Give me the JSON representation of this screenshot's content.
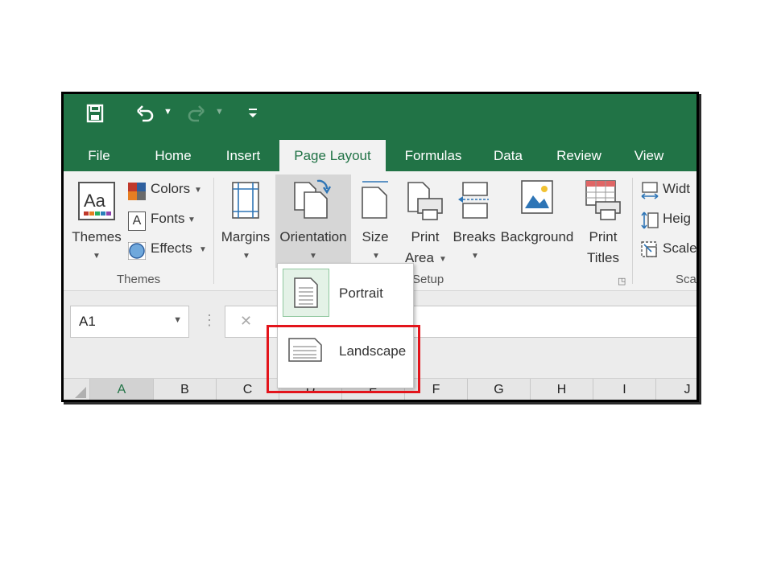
{
  "qat": {
    "save_icon": "save-icon",
    "undo_icon": "undo-icon",
    "redo_icon": "redo-icon",
    "customize_icon": "customize-qat-icon"
  },
  "tabs": [
    "File",
    "Home",
    "Insert",
    "Page Layout",
    "Formulas",
    "Data",
    "Review",
    "View"
  ],
  "ribbon": {
    "themes": {
      "label": "Themes",
      "colors": "Colors",
      "fonts": "Fonts",
      "effects": "Effects",
      "group_label": "Themes"
    },
    "page_setup": {
      "margins": "Margins",
      "orientation": "Orientation",
      "size": "Size",
      "print_area_line1": "Print",
      "print_area_line2": "Area",
      "breaks": "Breaks",
      "background": "Background",
      "print_titles_line1": "Print",
      "print_titles_line2": "Titles",
      "group_label_partial": "Setup"
    },
    "scale_to_fit": {
      "width": "Widt",
      "height": "Heig",
      "scale": "Scale",
      "group_label_partial": "Sca"
    }
  },
  "orientation_menu": {
    "portrait": "Portrait",
    "landscape": "Landscape"
  },
  "name_box": {
    "value": "A1"
  },
  "formula_bar": {
    "cancel": "✕",
    "more": "⋮"
  },
  "columns": [
    "A",
    "B",
    "C",
    "D",
    "E",
    "F",
    "G",
    "H",
    "I",
    "J"
  ],
  "colors": {
    "excel_green": "#217346",
    "highlight_red": "#e3141b"
  }
}
